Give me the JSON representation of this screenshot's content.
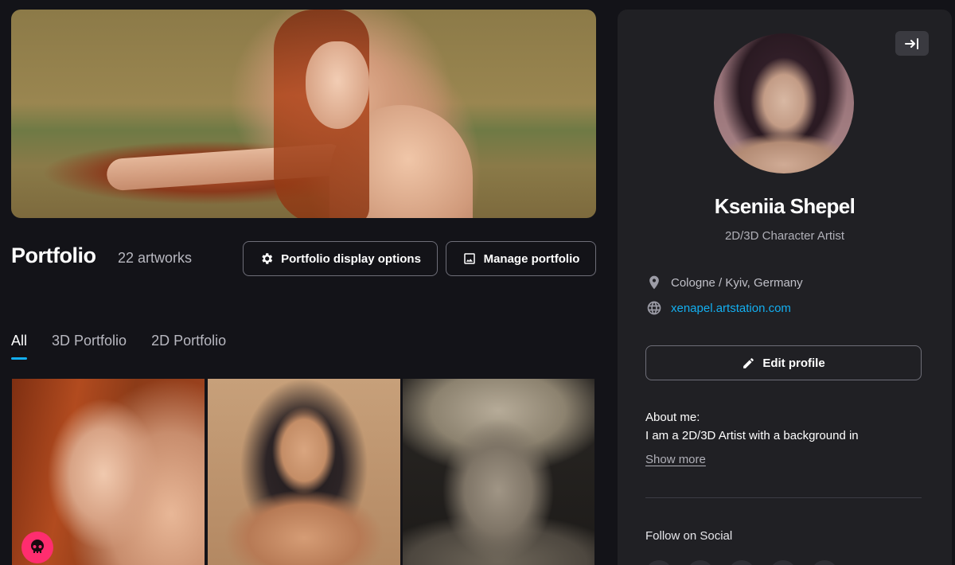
{
  "portfolio": {
    "title": "Portfolio",
    "count": "22 artworks",
    "display_options_label": "Portfolio display options",
    "manage_label": "Manage portfolio"
  },
  "tabs": [
    {
      "label": "All",
      "active": true
    },
    {
      "label": "3D Portfolio",
      "active": false
    },
    {
      "label": "2D Portfolio",
      "active": false
    }
  ],
  "profile": {
    "name": "Kseniia Shepel",
    "role": "2D/3D Character Artist",
    "location": "Cologne / Kyiv, Germany",
    "website": "xenapel.artstation.com",
    "edit_label": "Edit profile",
    "about_title": "About me:",
    "about_text": "I am a 2D/3D Artist with a background in",
    "show_more": "Show more",
    "follow_title": "Follow on Social"
  },
  "icons": {
    "collapse": "collapse-panel-icon",
    "gear": "gear-icon",
    "image": "image-icon",
    "location": "location-pin-icon",
    "globe": "globe-icon",
    "pencil": "pencil-icon",
    "badge": "skull-badge-icon"
  },
  "colors": {
    "background": "#131318",
    "panel": "#202024",
    "accent": "#13aff0",
    "badge": "#ff2d6f"
  }
}
